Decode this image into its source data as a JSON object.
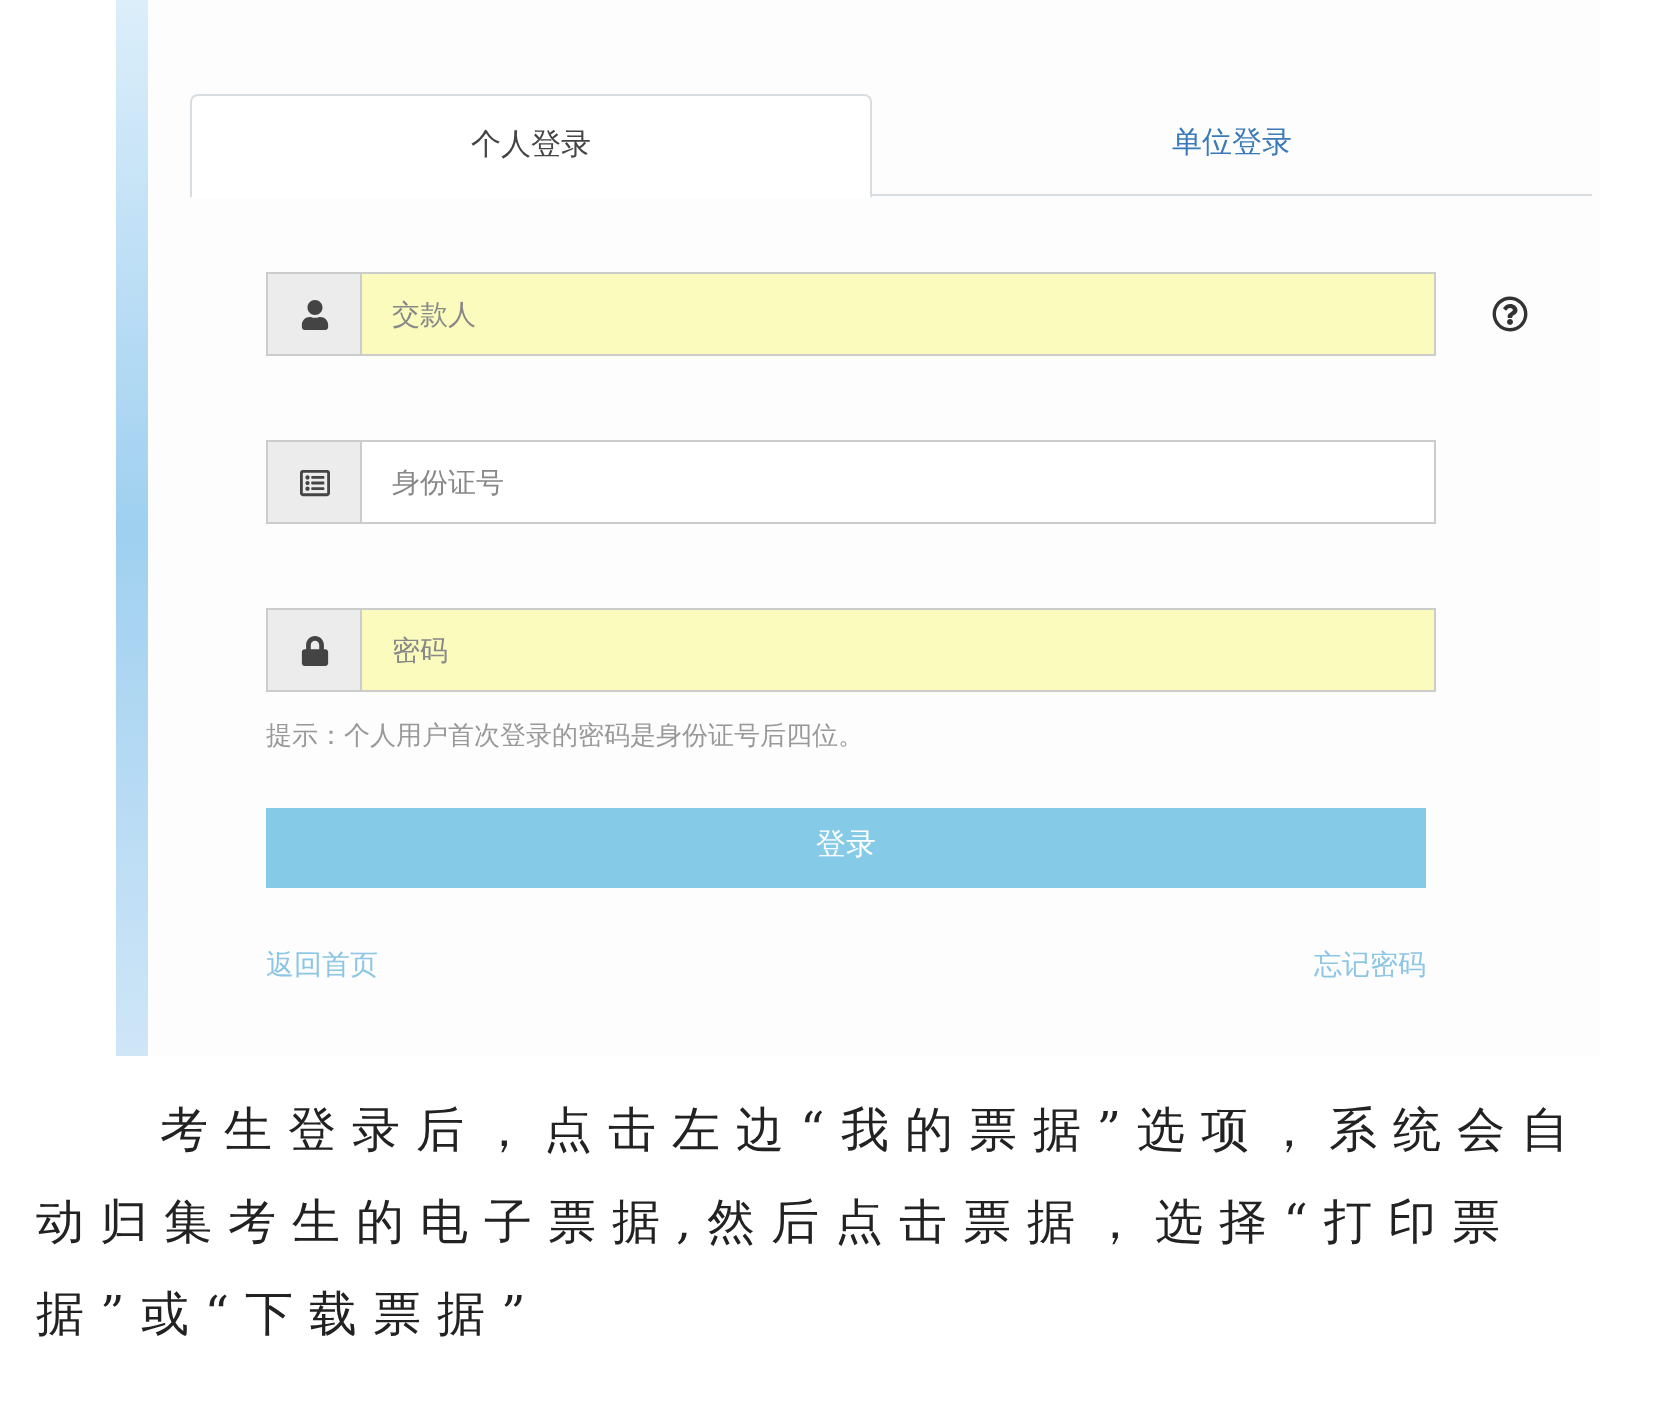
{
  "tabs": [
    {
      "label": "个人登录",
      "selected": true
    },
    {
      "label": "单位登录",
      "selected": false
    }
  ],
  "fields": [
    {
      "kind": "user",
      "placeholder": "交款人",
      "autofilled": true,
      "help": true
    },
    {
      "kind": "id-card",
      "placeholder": "身份证号",
      "autofilled": false,
      "help": false
    },
    {
      "kind": "lock",
      "placeholder": "密码",
      "autofilled": true,
      "help": false
    }
  ],
  "hint": "提示：个人用户首次登录的密码是身份证号后四位。",
  "login_button": "登录",
  "links": [
    "返回首页",
    "忘记密码"
  ],
  "paragraph": "考生登录后，点击左边“我的票据”选项，系统会自动归集考生的电子票据,然后点击票据，选择“打印票据”或“下载票据”"
}
